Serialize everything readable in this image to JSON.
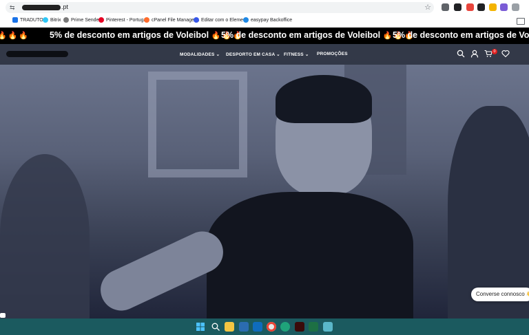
{
  "browser": {
    "url_suffix": ".pt",
    "bookmarks": [
      "TRADUTOR",
      "Bitrix",
      "Prime Sender",
      "Pinterest - Portugal",
      "cPanel File Manager...",
      "Editar com o Eleme...",
      "easypay Backoffice"
    ]
  },
  "ticker": {
    "text": "5% de desconto em artigos de Voleibol",
    "flames": "🔥🔥🔥"
  },
  "nav": {
    "items": [
      "MODALIDADES",
      "DESPORTO EM CASA",
      "FITNESS",
      "PROMOÇÕES"
    ],
    "cart_count": "0"
  },
  "chat": {
    "label": "Converse connosco 👋"
  },
  "colors": {
    "ticker_bg": "#000000",
    "badge": "#e02020",
    "taskbar": "#1b5a5f"
  },
  "icons": [
    "tune-icon",
    "star-icon",
    "search-icon",
    "user-icon",
    "cart-icon",
    "heart-icon",
    "chevron-down-icon",
    "windows-start-icon"
  ]
}
